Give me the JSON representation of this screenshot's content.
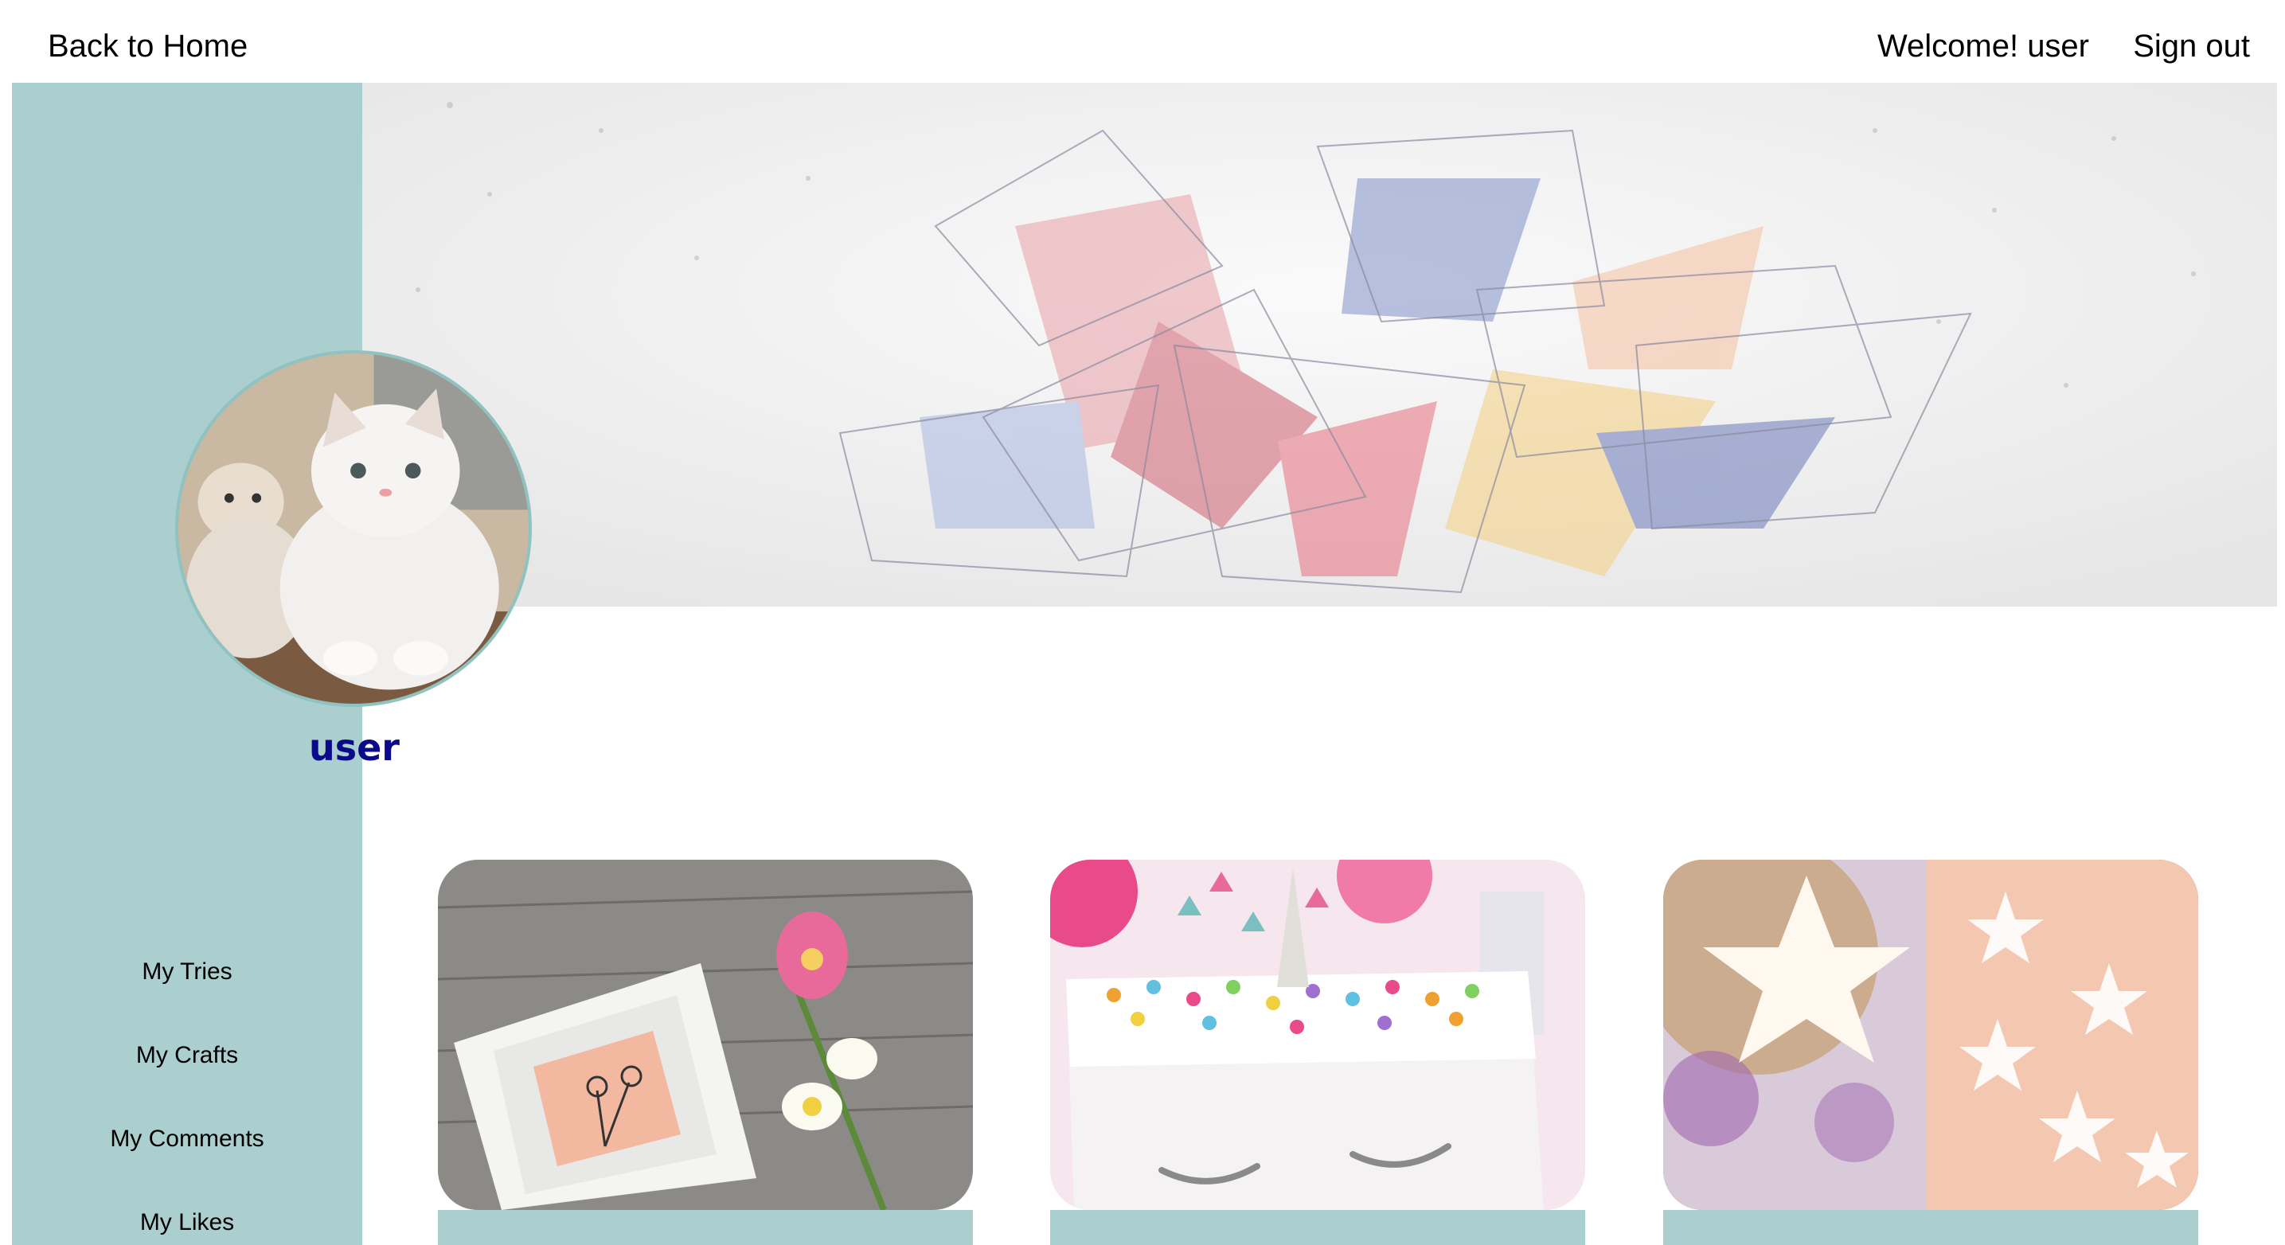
{
  "header": {
    "back_label": "Back to Home",
    "welcome_text": "Welcome! user",
    "signout_label": "Sign out"
  },
  "profile": {
    "username": "user"
  },
  "sidebar": {
    "items": [
      {
        "label": "My Tries"
      },
      {
        "label": "My Crafts"
      },
      {
        "label": "My Comments"
      },
      {
        "label": "My Likes"
      }
    ]
  },
  "colors": {
    "sidebar_bg": "#abcecf",
    "username": "#0b0b8a",
    "card_footer": "#abcecf"
  },
  "cards": [
    {
      "image": "framed-flower-art-image"
    },
    {
      "image": "unicorn-box-image"
    },
    {
      "image": "star-tshirts-image"
    }
  ]
}
